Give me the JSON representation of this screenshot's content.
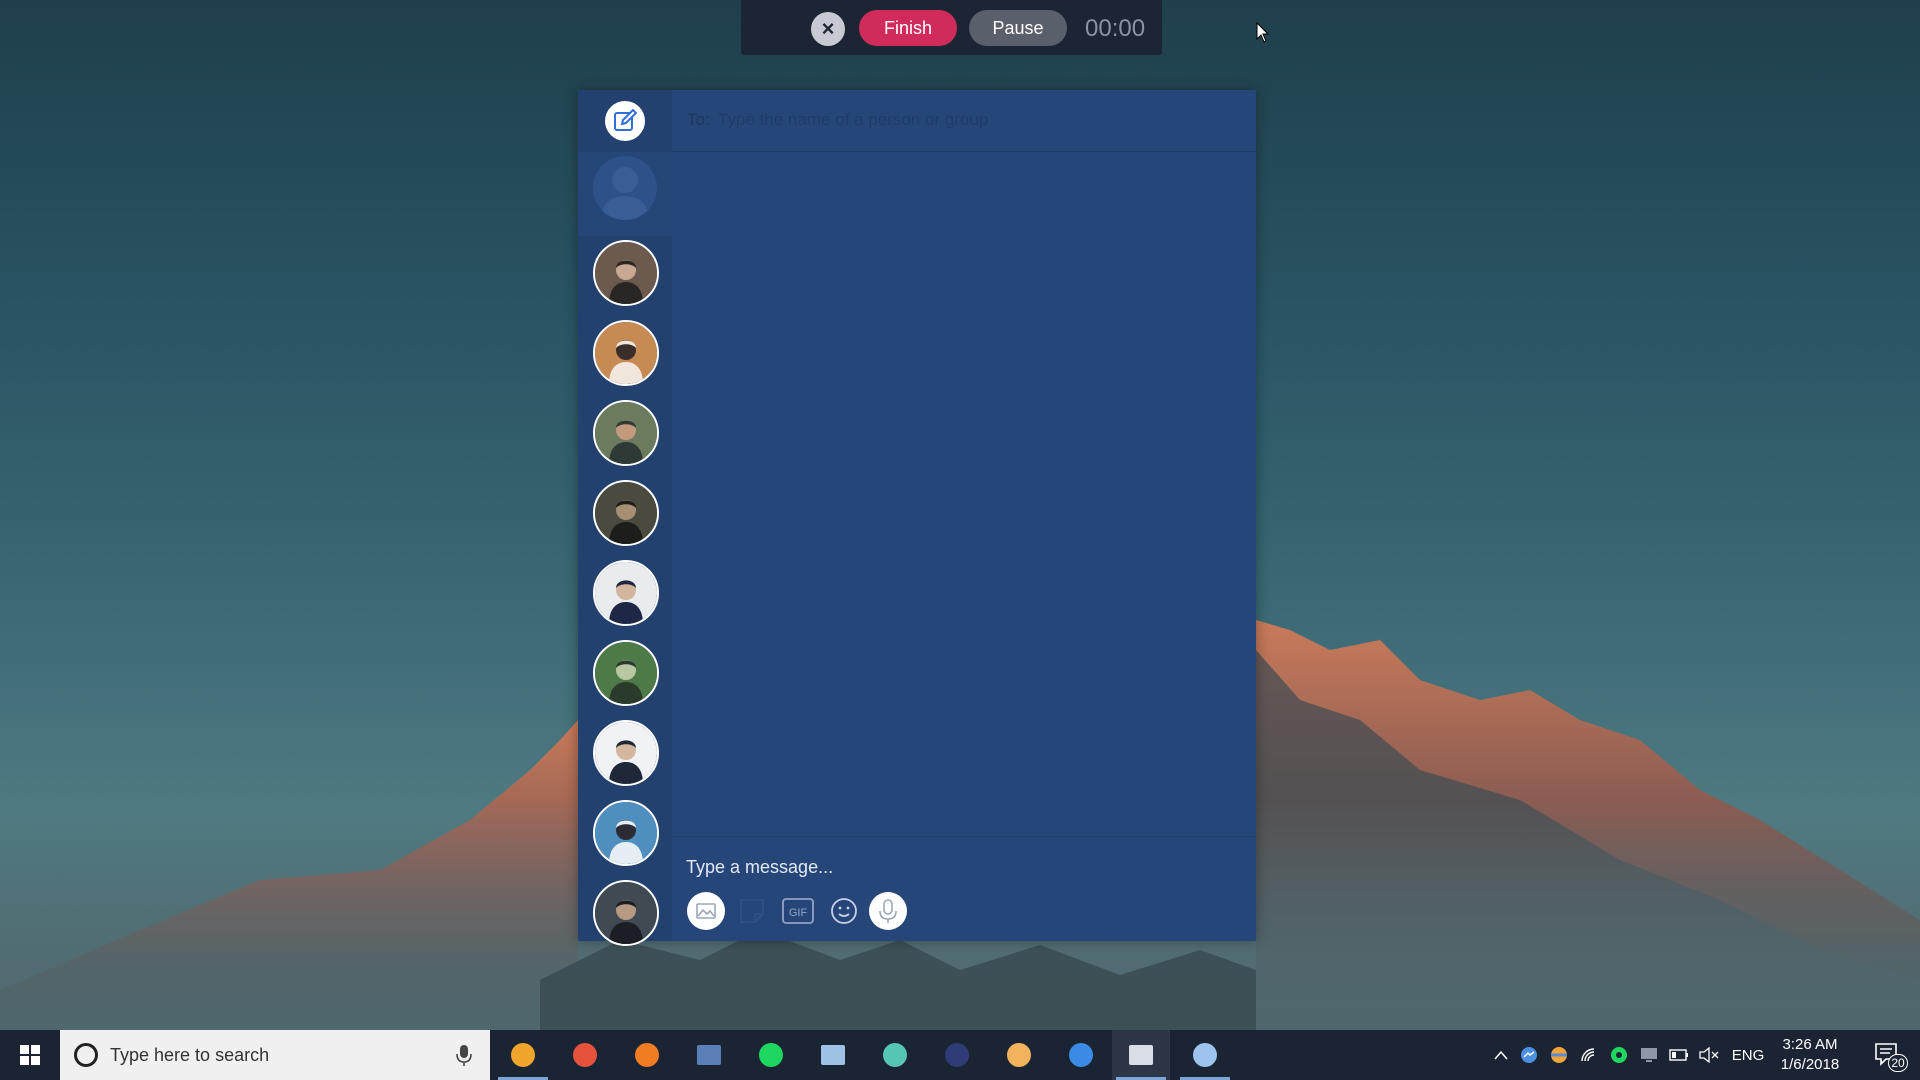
{
  "recorder": {
    "close_icon": "×",
    "finish_label": "Finish",
    "pause_label": "Pause",
    "timer": "00:00"
  },
  "messenger": {
    "to_label": "To:",
    "to_placeholder": "Type the name of a person or group",
    "message_placeholder": "Type a message...",
    "compose_icon": "compose-icon",
    "contacts": [
      {
        "name": "contact-1",
        "palette": [
          "#6d5a4e",
          "#2a2624",
          "#c9a993"
        ]
      },
      {
        "name": "contact-2",
        "palette": [
          "#c68a52",
          "#f1e6dc",
          "#3a2e2a"
        ]
      },
      {
        "name": "contact-3",
        "palette": [
          "#6b7b5e",
          "#2e3a36",
          "#c49a7e"
        ]
      },
      {
        "name": "contact-4",
        "palette": [
          "#4a4a3e",
          "#1d1d1a",
          "#a78f73"
        ]
      },
      {
        "name": "contact-5",
        "palette": [
          "#e9ecef",
          "#1e2744",
          "#d3b59c"
        ]
      },
      {
        "name": "contact-6",
        "palette": [
          "#4e7a48",
          "#2a3b2b",
          "#b9c8a0"
        ]
      },
      {
        "name": "contact-7",
        "palette": [
          "#f0f2f5",
          "#1f2838",
          "#d4b69c"
        ]
      },
      {
        "name": "contact-8",
        "palette": [
          "#4f8fc0",
          "#e6eef3",
          "#2b2b33"
        ]
      },
      {
        "name": "contact-9",
        "palette": [
          "#3f4a52",
          "#1b1e24",
          "#b79a84"
        ]
      }
    ]
  },
  "taskbar": {
    "search_placeholder": "Type here to search",
    "language": "ENG",
    "time": "3:26 AM",
    "date": "1/6/2018",
    "notification_count": "20",
    "apps": [
      {
        "name": "taskbar-app-cloud-storage-1",
        "color": "#f0a52c"
      },
      {
        "name": "taskbar-app-chrome",
        "color": "#e5533d"
      },
      {
        "name": "taskbar-app-firefox",
        "color": "#f07c24"
      },
      {
        "name": "taskbar-app-file-explorer",
        "color": "#5a7fb8"
      },
      {
        "name": "taskbar-app-spotify",
        "color": "#1ed760"
      },
      {
        "name": "taskbar-app-photos",
        "color": "#9fc1e6"
      },
      {
        "name": "taskbar-app-slack",
        "color": "#55c6b2"
      },
      {
        "name": "taskbar-app-dark-blue",
        "color": "#2f3c78"
      },
      {
        "name": "taskbar-app-avatar",
        "color": "#f2b35c"
      },
      {
        "name": "taskbar-app-messenger",
        "color": "#3b8be6"
      },
      {
        "name": "taskbar-app-editor",
        "color": "#d9dde6"
      },
      {
        "name": "taskbar-app-cloud",
        "color": "#9cc4ec"
      }
    ]
  }
}
